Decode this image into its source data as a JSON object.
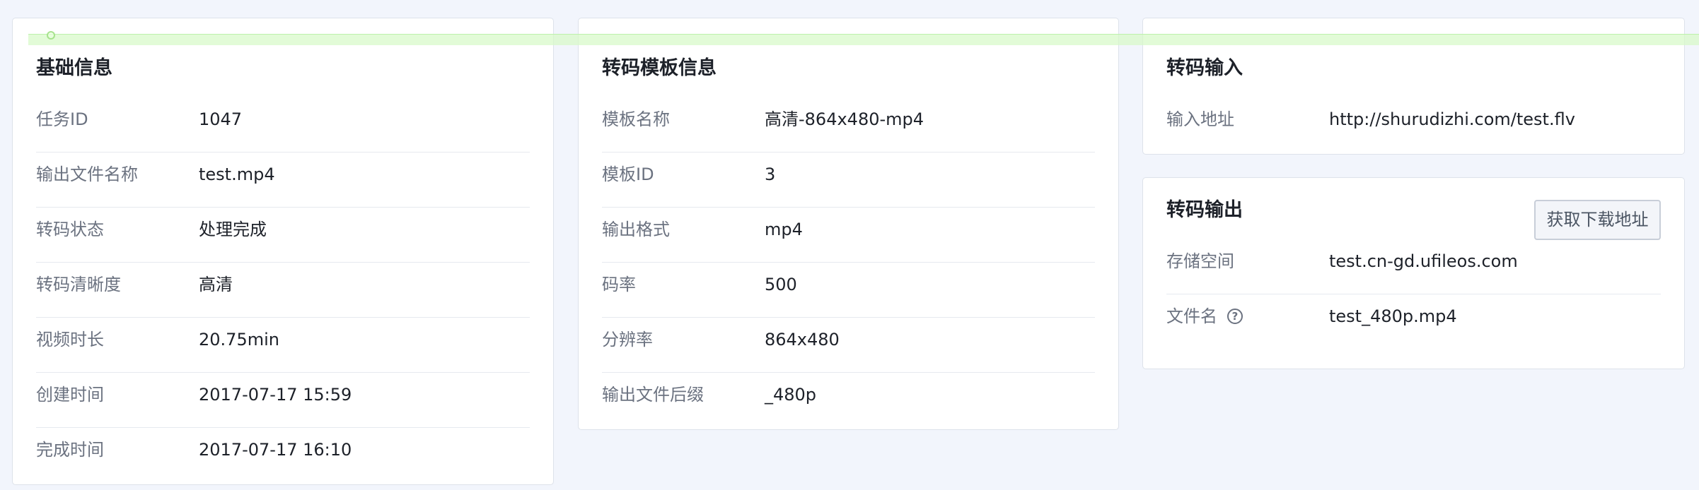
{
  "basic_info": {
    "title": "基础信息",
    "rows": [
      {
        "label": "任务ID",
        "value": "1047"
      },
      {
        "label": "输出文件名称",
        "value": "test.mp4"
      },
      {
        "label": "转码状态",
        "value": "处理完成"
      },
      {
        "label": "转码清晰度",
        "value": "高清"
      },
      {
        "label": "视频时长",
        "value": "20.75min"
      },
      {
        "label": "创建时间",
        "value": "2017-07-17 15:59"
      },
      {
        "label": "完成时间",
        "value": "2017-07-17 16:10"
      }
    ]
  },
  "template_info": {
    "title": "转码模板信息",
    "rows": [
      {
        "label": "模板名称",
        "value": "高清-864x480-mp4"
      },
      {
        "label": "模板ID",
        "value": "3"
      },
      {
        "label": "输出格式",
        "value": "mp4"
      },
      {
        "label": "码率",
        "value": "500"
      },
      {
        "label": "分辨率",
        "value": "864x480"
      },
      {
        "label": "输出文件后缀",
        "value": "_480p"
      }
    ]
  },
  "transcode_input": {
    "title": "转码输入",
    "rows": [
      {
        "label": "输入地址",
        "value": "http://shurudizhi.com/test.flv"
      }
    ]
  },
  "transcode_output": {
    "title": "转码输出",
    "button_label": "获取下载地址",
    "rows": [
      {
        "label": "存储空间",
        "value": "test.cn-gd.ufileos.com"
      },
      {
        "label": "文件名",
        "value": "test_480p.mp4",
        "icon": "help-icon",
        "icon_glyph": "?"
      }
    ]
  },
  "colors": {
    "background": "#f2f5fc",
    "card": "#ffffff",
    "label": "#6b7280",
    "value": "#1d2129",
    "divider": "#e6e9ef"
  }
}
